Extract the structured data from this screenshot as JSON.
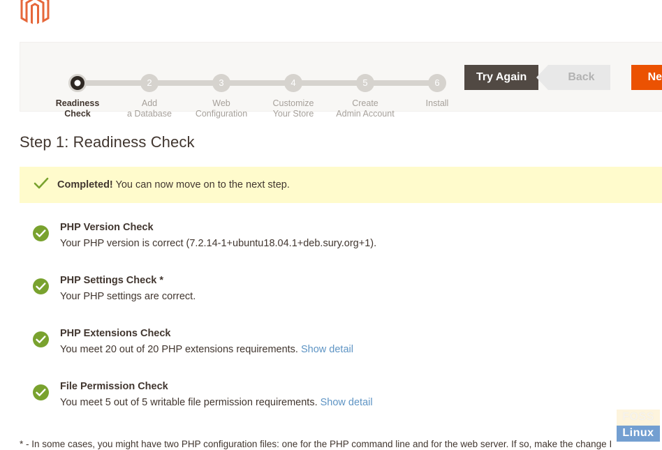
{
  "brand": {
    "logo_name": "magento-logo",
    "logo_color": "#e6673a"
  },
  "wizard": {
    "steps": [
      {
        "number": "1",
        "label": "Readiness\nCheck",
        "active": true
      },
      {
        "number": "2",
        "label": "Add\na Database",
        "active": false
      },
      {
        "number": "3",
        "label": "Web\nConfiguration",
        "active": false
      },
      {
        "number": "4",
        "label": "Customize\nYour Store",
        "active": false
      },
      {
        "number": "5",
        "label": "Create\nAdmin Account",
        "active": false
      },
      {
        "number": "6",
        "label": "Install",
        "active": false
      }
    ],
    "buttons": {
      "try_again": "Try Again",
      "back": "Back",
      "next": "Next"
    },
    "colors": {
      "next_button": "#eb5202",
      "try_again_button": "#514943",
      "back_button": "#e8e8e8",
      "active_step": "#2e2823",
      "inactive_step": "#d6d3ce"
    }
  },
  "main": {
    "title": "Step 1: Readiness Check",
    "banner": {
      "icon": "check-mark-icon",
      "strong": "Completed!",
      "text": " You can now move on to the next step.",
      "background": "#fffbcc",
      "icon_color": "#79a22e"
    },
    "checks": [
      {
        "title": "PHP Version Check",
        "description": "Your PHP version is correct (7.2.14-1+ubuntu18.04.1+deb.sury.org+1).",
        "link": "",
        "status": "success"
      },
      {
        "title": "PHP Settings Check *",
        "description": "Your PHP settings are correct.",
        "link": "",
        "status": "success"
      },
      {
        "title": "PHP Extensions Check",
        "description": "You meet 20 out of 20 PHP extensions requirements. ",
        "link": "Show detail",
        "status": "success"
      },
      {
        "title": "File Permission Check",
        "description": "You meet 5 out of 5 writable file permission requirements. ",
        "link": "Show detail",
        "status": "success"
      }
    ],
    "check_icon_color": "#79a22e",
    "link_color": "#5e94c4",
    "footnote": "* - In some cases, you might have two PHP configuration files: one for the PHP command line and for the web server. If so, make the change I"
  },
  "watermark": {
    "line1": "FOSS",
    "line2": "Linux"
  }
}
